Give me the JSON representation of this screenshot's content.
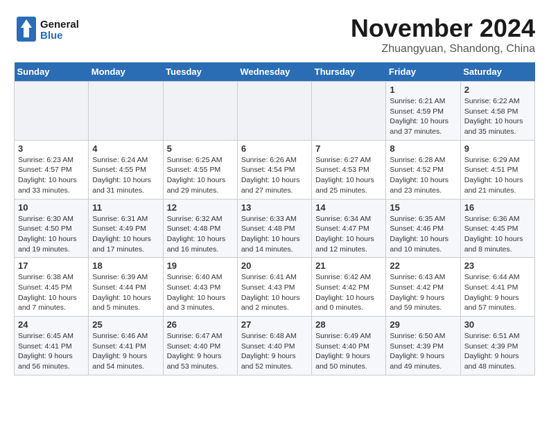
{
  "header": {
    "logo_line1": "General",
    "logo_line2": "Blue",
    "month": "November 2024",
    "location": "Zhuangyuan, Shandong, China"
  },
  "days_of_week": [
    "Sunday",
    "Monday",
    "Tuesday",
    "Wednesday",
    "Thursday",
    "Friday",
    "Saturday"
  ],
  "weeks": [
    [
      {
        "day": "",
        "info": ""
      },
      {
        "day": "",
        "info": ""
      },
      {
        "day": "",
        "info": ""
      },
      {
        "day": "",
        "info": ""
      },
      {
        "day": "",
        "info": ""
      },
      {
        "day": "1",
        "info": "Sunrise: 6:21 AM\nSunset: 4:59 PM\nDaylight: 10 hours and 37 minutes."
      },
      {
        "day": "2",
        "info": "Sunrise: 6:22 AM\nSunset: 4:58 PM\nDaylight: 10 hours and 35 minutes."
      }
    ],
    [
      {
        "day": "3",
        "info": "Sunrise: 6:23 AM\nSunset: 4:57 PM\nDaylight: 10 hours and 33 minutes."
      },
      {
        "day": "4",
        "info": "Sunrise: 6:24 AM\nSunset: 4:55 PM\nDaylight: 10 hours and 31 minutes."
      },
      {
        "day": "5",
        "info": "Sunrise: 6:25 AM\nSunset: 4:55 PM\nDaylight: 10 hours and 29 minutes."
      },
      {
        "day": "6",
        "info": "Sunrise: 6:26 AM\nSunset: 4:54 PM\nDaylight: 10 hours and 27 minutes."
      },
      {
        "day": "7",
        "info": "Sunrise: 6:27 AM\nSunset: 4:53 PM\nDaylight: 10 hours and 25 minutes."
      },
      {
        "day": "8",
        "info": "Sunrise: 6:28 AM\nSunset: 4:52 PM\nDaylight: 10 hours and 23 minutes."
      },
      {
        "day": "9",
        "info": "Sunrise: 6:29 AM\nSunset: 4:51 PM\nDaylight: 10 hours and 21 minutes."
      }
    ],
    [
      {
        "day": "10",
        "info": "Sunrise: 6:30 AM\nSunset: 4:50 PM\nDaylight: 10 hours and 19 minutes."
      },
      {
        "day": "11",
        "info": "Sunrise: 6:31 AM\nSunset: 4:49 PM\nDaylight: 10 hours and 17 minutes."
      },
      {
        "day": "12",
        "info": "Sunrise: 6:32 AM\nSunset: 4:48 PM\nDaylight: 10 hours and 16 minutes."
      },
      {
        "day": "13",
        "info": "Sunrise: 6:33 AM\nSunset: 4:48 PM\nDaylight: 10 hours and 14 minutes."
      },
      {
        "day": "14",
        "info": "Sunrise: 6:34 AM\nSunset: 4:47 PM\nDaylight: 10 hours and 12 minutes."
      },
      {
        "day": "15",
        "info": "Sunrise: 6:35 AM\nSunset: 4:46 PM\nDaylight: 10 hours and 10 minutes."
      },
      {
        "day": "16",
        "info": "Sunrise: 6:36 AM\nSunset: 4:45 PM\nDaylight: 10 hours and 8 minutes."
      }
    ],
    [
      {
        "day": "17",
        "info": "Sunrise: 6:38 AM\nSunset: 4:45 PM\nDaylight: 10 hours and 7 minutes."
      },
      {
        "day": "18",
        "info": "Sunrise: 6:39 AM\nSunset: 4:44 PM\nDaylight: 10 hours and 5 minutes."
      },
      {
        "day": "19",
        "info": "Sunrise: 6:40 AM\nSunset: 4:43 PM\nDaylight: 10 hours and 3 minutes."
      },
      {
        "day": "20",
        "info": "Sunrise: 6:41 AM\nSunset: 4:43 PM\nDaylight: 10 hours and 2 minutes."
      },
      {
        "day": "21",
        "info": "Sunrise: 6:42 AM\nSunset: 4:42 PM\nDaylight: 10 hours and 0 minutes."
      },
      {
        "day": "22",
        "info": "Sunrise: 6:43 AM\nSunset: 4:42 PM\nDaylight: 9 hours and 59 minutes."
      },
      {
        "day": "23",
        "info": "Sunrise: 6:44 AM\nSunset: 4:41 PM\nDaylight: 9 hours and 57 minutes."
      }
    ],
    [
      {
        "day": "24",
        "info": "Sunrise: 6:45 AM\nSunset: 4:41 PM\nDaylight: 9 hours and 56 minutes."
      },
      {
        "day": "25",
        "info": "Sunrise: 6:46 AM\nSunset: 4:41 PM\nDaylight: 9 hours and 54 minutes."
      },
      {
        "day": "26",
        "info": "Sunrise: 6:47 AM\nSunset: 4:40 PM\nDaylight: 9 hours and 53 minutes."
      },
      {
        "day": "27",
        "info": "Sunrise: 6:48 AM\nSunset: 4:40 PM\nDaylight: 9 hours and 52 minutes."
      },
      {
        "day": "28",
        "info": "Sunrise: 6:49 AM\nSunset: 4:40 PM\nDaylight: 9 hours and 50 minutes."
      },
      {
        "day": "29",
        "info": "Sunrise: 6:50 AM\nSunset: 4:39 PM\nDaylight: 9 hours and 49 minutes."
      },
      {
        "day": "30",
        "info": "Sunrise: 6:51 AM\nSunset: 4:39 PM\nDaylight: 9 hours and 48 minutes."
      }
    ]
  ]
}
